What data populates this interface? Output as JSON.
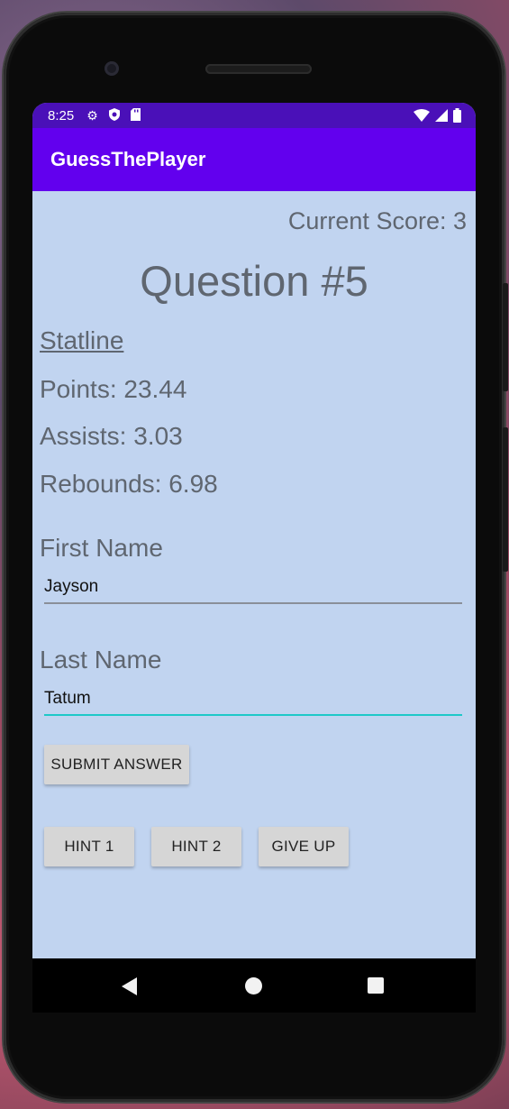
{
  "status_bar": {
    "time": "8:25",
    "left_icons": [
      "gear-icon",
      "shield-icon",
      "sd-card-icon"
    ],
    "right_icons": [
      "wifi-icon",
      "cell-signal-icon",
      "battery-icon"
    ]
  },
  "app_bar": {
    "title": "GuessThePlayer"
  },
  "score": {
    "text": "Current Score: 3"
  },
  "question": {
    "title": "Question #5"
  },
  "statline": {
    "heading": "Statline",
    "points": "Points: 23.44",
    "assists": "Assists: 3.03",
    "rebounds": "Rebounds: 6.98"
  },
  "form": {
    "first_name_label": "First Name",
    "first_name_value": "Jayson",
    "last_name_label": "Last Name",
    "last_name_value": "Tatum",
    "submit_label": "SUBMIT ANSWER"
  },
  "actions": {
    "hint1_label": "HINT 1",
    "hint2_label": "HINT 2",
    "give_up_label": "GIVE UP"
  },
  "colors": {
    "status_bar": "#4a10b8",
    "app_bar": "#6200ee",
    "screen_background": "#c1d4f0",
    "focused_underline": "#1ec8c8",
    "unfocused_underline": "#8a8f99",
    "button": "#d6d6d6"
  }
}
